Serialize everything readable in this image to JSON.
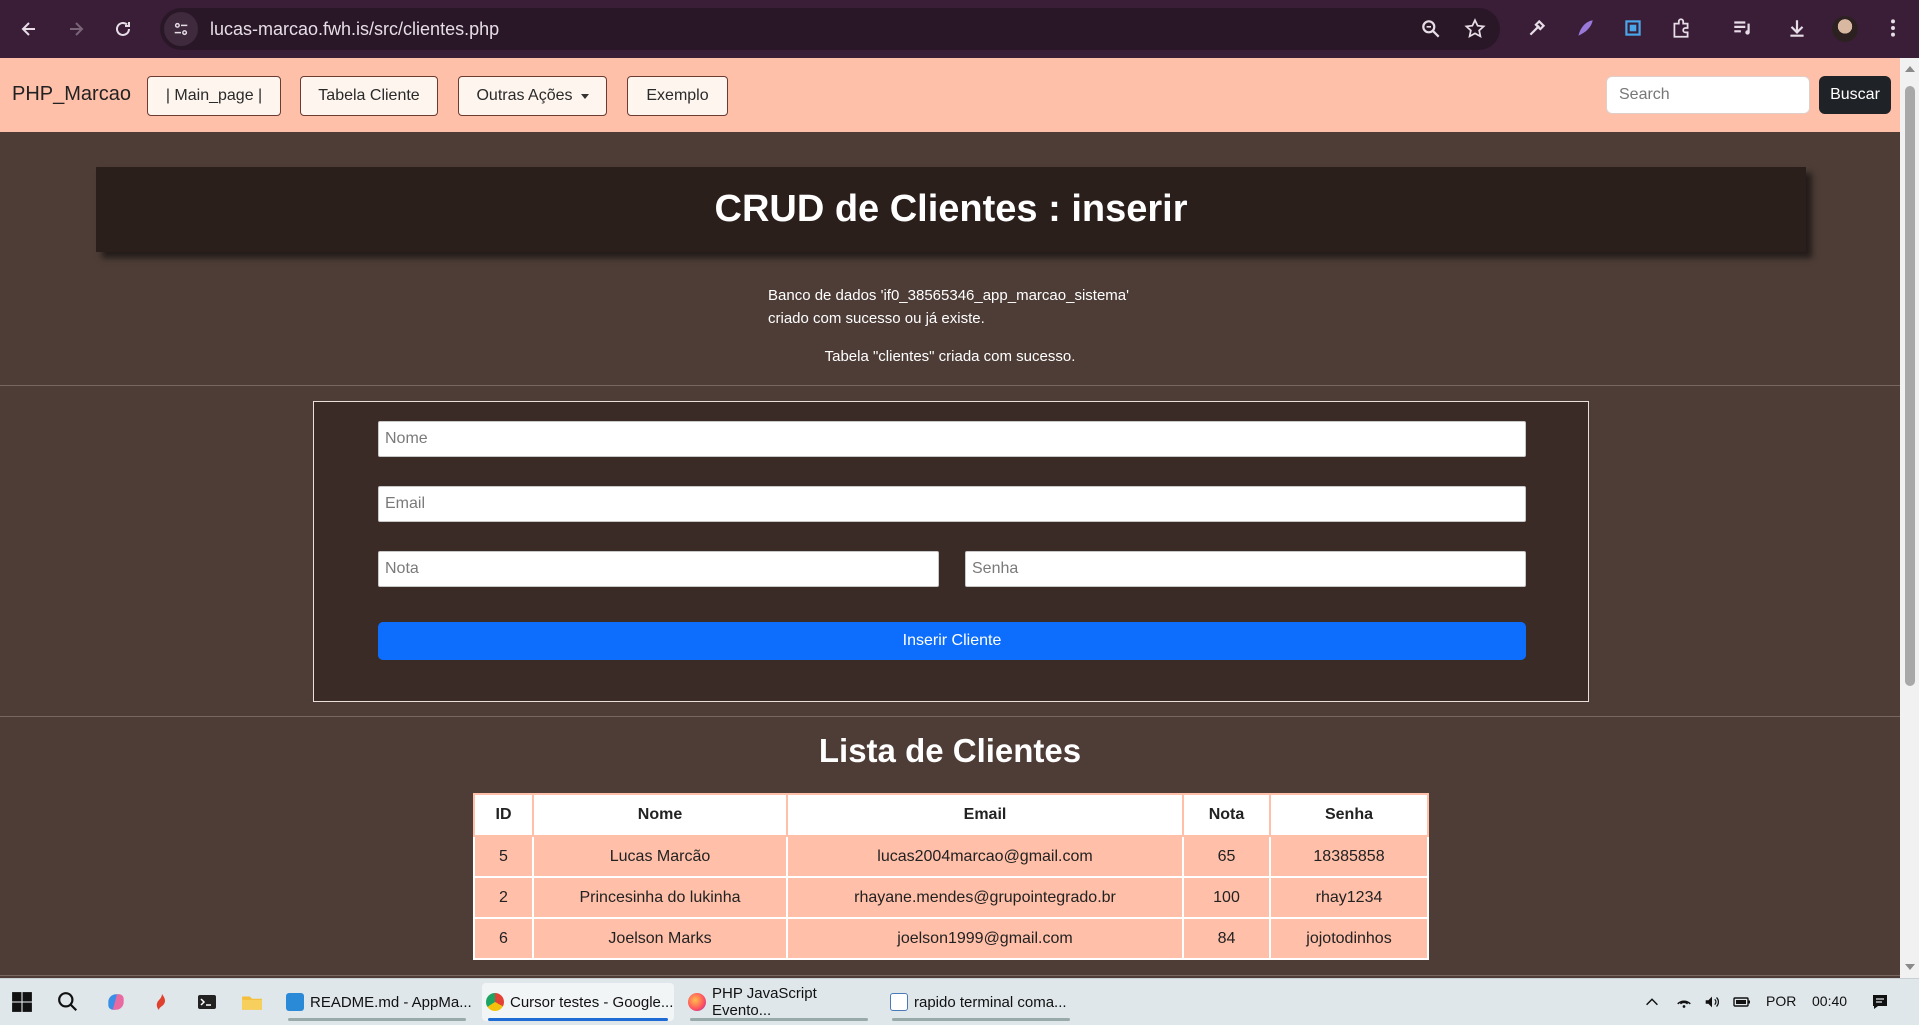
{
  "browser": {
    "url": "lucas-marcao.fwh.is/src/clientes.php"
  },
  "navbar": {
    "brand": "PHP_Marcao",
    "links": [
      "| Main_page |",
      "Tabela Cliente",
      "Outras Ações",
      "Exemplo"
    ],
    "search_placeholder": "Search",
    "search_button": "Buscar"
  },
  "page": {
    "title": "CRUD de Clientes : inserir",
    "db_message_line1": "Banco de dados 'if0_38565346_app_marcao_sistema'",
    "db_message_line2": "criado com sucesso ou já existe.",
    "table_message": "Tabela \"clientes\" criada com sucesso."
  },
  "form": {
    "nome_placeholder": "Nome",
    "email_placeholder": "Email",
    "nota_placeholder": "Nota",
    "senha_placeholder": "Senha",
    "submit_label": "Inserir Cliente",
    "submit_color": "#0d6efd"
  },
  "clients": {
    "title": "Lista de Clientes",
    "headers": [
      "ID",
      "Nome",
      "Email",
      "Nota",
      "Senha"
    ],
    "rows": [
      [
        "5",
        "Lucas Marcão",
        "lucas2004marcao@gmail.com",
        "65",
        "18385858"
      ],
      [
        "2",
        "Princesinha do lukinha",
        "rhayane.mendes@grupointegrado.br",
        "100",
        "rhay1234"
      ],
      [
        "6",
        "Joelson Marks",
        "joelson1999@gmail.com",
        "84",
        "jojotodinhos"
      ]
    ]
  },
  "taskbar": {
    "apps": [
      {
        "label": "README.md - AppMa...",
        "icon": "vscode-icon"
      },
      {
        "label": "Cursor testes - Google...",
        "icon": "chrome-icon"
      },
      {
        "label": "PHP JavaScript Evento...",
        "icon": "firefox-icon"
      },
      {
        "label": "rapido terminal coma...",
        "icon": "notepad-icon"
      }
    ],
    "language": "POR",
    "time": "00:40"
  },
  "colors": {
    "navbar_bg": "#ffc0aa",
    "page_bg": "#4e3d37",
    "header_bg": "#2b1f1c",
    "table_row_bg": "#ffbfa8"
  }
}
